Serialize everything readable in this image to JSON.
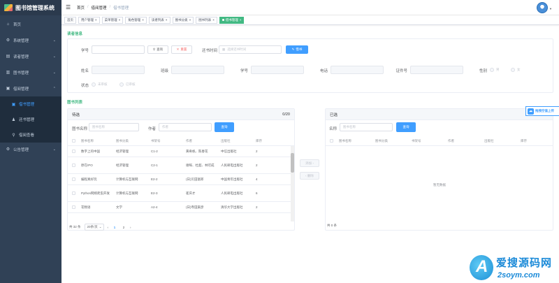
{
  "app": {
    "title": "图书馆管理系统"
  },
  "sidebar": {
    "items": [
      {
        "label": "首页",
        "icon": "home-icon"
      },
      {
        "label": "系统管理",
        "icon": "gear-icon"
      },
      {
        "label": "读者管理",
        "icon": "reader-card-icon"
      },
      {
        "label": "图书管理",
        "icon": "book-icon"
      },
      {
        "label": "借阅管理",
        "icon": "borrow-icon"
      },
      {
        "label": "公告管理",
        "icon": "notice-icon"
      }
    ],
    "subitems": [
      {
        "label": "借书管理",
        "icon": "borrow-book-icon"
      },
      {
        "label": "还书管理",
        "icon": "return-book-icon"
      },
      {
        "label": "借阅查看",
        "icon": "borrow-view-icon"
      }
    ]
  },
  "header": {
    "breadcrumb": [
      "首页",
      "借阅管理",
      "借书管理"
    ]
  },
  "tags": [
    "首页",
    "用户管理",
    "菜单管理",
    "角色管理",
    "读者列表",
    "图书分类",
    "图书列表",
    "借书管理"
  ],
  "reader": {
    "title": "读者信息",
    "sno_label": "学号",
    "query_label": "查询",
    "reset_label": "重置",
    "return_time_label": "还书时间",
    "return_time_placeholder": "选择还书时间",
    "borrow_label": "借书",
    "name_label": "姓名",
    "class_label": "班级",
    "sno2_label": "学号",
    "phone_label": "电话",
    "idcard_label": "证件号",
    "gender_label": "性别",
    "gender_male": "男",
    "gender_female": "女",
    "status_label": "状态",
    "status_a": "未审核",
    "status_b": "已审核"
  },
  "books": {
    "title": "图书列表",
    "left": {
      "title": "待选",
      "count": "0/20",
      "name_label": "图书名称",
      "name_placeholder": "图书名称",
      "author_label": "作者",
      "author_placeholder": "作者",
      "query_label": "查询",
      "columns": [
        "图书名称",
        "图书分类",
        "书架号",
        "作者",
        "出版社",
        "库存"
      ],
      "rows": [
        [
          "数字上的中国",
          "经济管理",
          "C1-2",
          "黄奇帆、陈春花",
          "中信出版社",
          "2"
        ],
        [
          "原在IPO",
          "经济管理",
          "C2-1",
          "谢晖、杜超、林可成",
          "人民邮电出版社",
          "2"
        ],
        [
          "编程真好玩",
          "计算机与互联网",
          "E2-2",
          "(日)贝田富郎",
          "中国青年出版社",
          "4"
        ],
        [
          "Python网络爬虫开发",
          "计算机与互联网",
          "E2-3",
          "崔庆才",
          "人民邮电出版社",
          "6"
        ],
        [
          "花物语",
          "文学",
          "A2-4",
          "(日)寺田寅彦",
          "清华大学出版社",
          "2"
        ]
      ],
      "total": "共 32 条",
      "page_size": "20条/页",
      "pages": [
        "1",
        "2"
      ]
    },
    "add_label": "添加",
    "remove_label": "删除",
    "right": {
      "title": "已选",
      "name_label": "名称",
      "name_placeholder": "图书名称",
      "query_label": "查询",
      "columns": [
        "图书名称",
        "图书分类",
        "书架号",
        "作者",
        "出版社",
        "库存"
      ],
      "empty": "暂无数据",
      "total": "共 0 条"
    }
  },
  "float_button": "拖拽空值上传",
  "watermark": {
    "line1": "爱搜源码网",
    "line2": "2soym.com"
  },
  "colors": {
    "sidebar": "#304156",
    "accent": "#409eff",
    "green": "#42b983"
  }
}
